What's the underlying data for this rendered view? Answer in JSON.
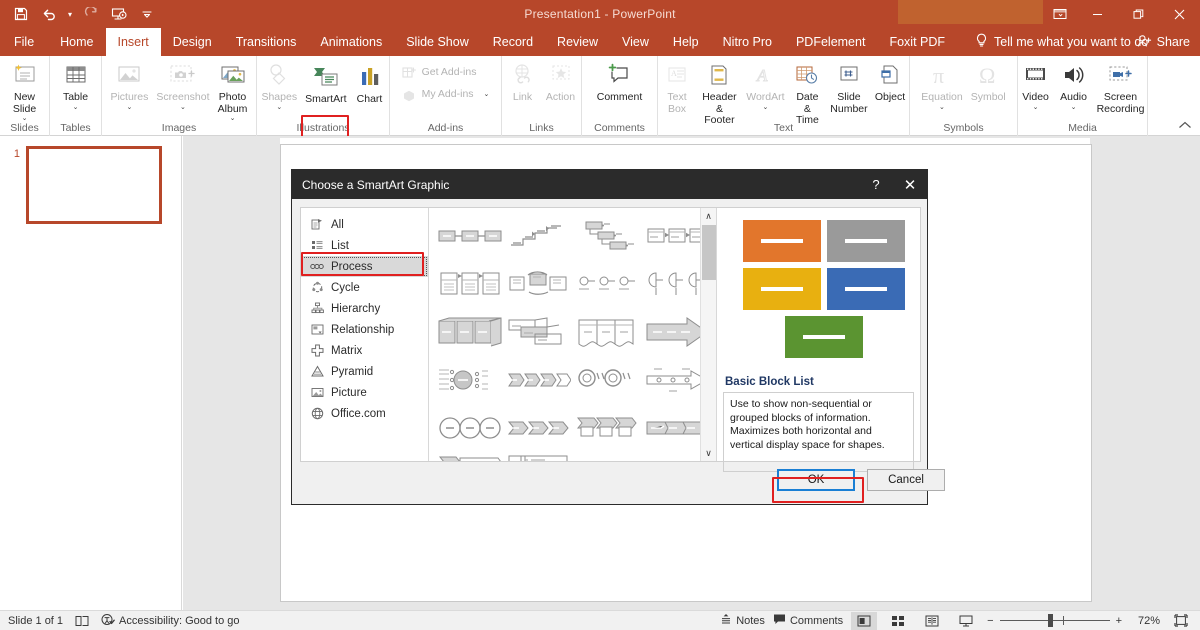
{
  "app": {
    "window_title": "Presentation1  -  PowerPoint",
    "quick_access": [
      {
        "name": "save-icon",
        "label": "Save"
      },
      {
        "name": "undo-icon",
        "label": "Undo"
      },
      {
        "name": "redo-icon",
        "label": "Redo"
      },
      {
        "name": "start-presentation-icon",
        "label": "Start From Beginning"
      },
      {
        "name": "customize-qat-icon",
        "label": "Customize Quick Access Toolbar"
      }
    ],
    "window_controls": [
      {
        "name": "ribbon-display-options",
        "glyph": "⬚"
      },
      {
        "name": "minimize",
        "glyph": "─"
      },
      {
        "name": "restore",
        "glyph": "❐"
      },
      {
        "name": "close",
        "glyph": "✕"
      }
    ],
    "theme_color": "#b7472a"
  },
  "tabs": [
    {
      "label": "File",
      "active": false
    },
    {
      "label": "Home",
      "active": false
    },
    {
      "label": "Insert",
      "active": true
    },
    {
      "label": "Design",
      "active": false
    },
    {
      "label": "Transitions",
      "active": false
    },
    {
      "label": "Animations",
      "active": false
    },
    {
      "label": "Slide Show",
      "active": false
    },
    {
      "label": "Record",
      "active": false
    },
    {
      "label": "Review",
      "active": false
    },
    {
      "label": "View",
      "active": false
    },
    {
      "label": "Help",
      "active": false
    },
    {
      "label": "Nitro Pro",
      "active": false
    },
    {
      "label": "PDFelement",
      "active": false
    },
    {
      "label": "Foxit PDF",
      "active": false
    }
  ],
  "tell_me": {
    "label": "Tell me what you want to do",
    "icon": "lightbulb-icon"
  },
  "share": {
    "label": "Share",
    "icon": "share-person-icon"
  },
  "ribbon": {
    "groups": [
      {
        "label": "Slides",
        "items": [
          {
            "label": "New\nSlide",
            "icon": "new-slide-icon",
            "dropdown": true,
            "disabled": false
          }
        ]
      },
      {
        "label": "Tables",
        "items": [
          {
            "label": "Table",
            "icon": "table-icon",
            "dropdown": true,
            "disabled": false
          }
        ]
      },
      {
        "label": "Images",
        "items": [
          {
            "label": "Pictures",
            "icon": "pictures-icon",
            "dropdown": true,
            "disabled": true
          },
          {
            "label": "Screenshot",
            "icon": "screenshot-icon",
            "dropdown": true,
            "disabled": true
          },
          {
            "label": "Photo\nAlbum",
            "icon": "photo-album-icon",
            "dropdown": true,
            "disabled": false
          }
        ]
      },
      {
        "label": "Illustrations",
        "items": [
          {
            "label": "Shapes",
            "icon": "shapes-icon",
            "dropdown": true,
            "disabled": true
          },
          {
            "label": "SmartArt",
            "icon": "smartart-icon",
            "dropdown": false,
            "disabled": false,
            "highlighted": true
          },
          {
            "label": "Chart",
            "icon": "chart-icon",
            "dropdown": false,
            "disabled": false
          }
        ]
      },
      {
        "label": "Add-ins",
        "items": [
          {
            "label": "Get Add-ins",
            "icon": "get-addins-icon",
            "disabled": true
          },
          {
            "label": "My Add-ins",
            "icon": "my-addins-icon",
            "dropdown": true,
            "disabled": true
          }
        ]
      },
      {
        "label": "Links",
        "items": [
          {
            "label": "Link",
            "icon": "link-icon",
            "disabled": true
          },
          {
            "label": "Action",
            "icon": "action-icon",
            "disabled": true
          }
        ]
      },
      {
        "label": "Comments",
        "items": [
          {
            "label": "Comment",
            "icon": "comment-icon",
            "disabled": false
          }
        ]
      },
      {
        "label": "Text",
        "items": [
          {
            "label": "Text\nBox",
            "icon": "text-box-icon",
            "disabled": true
          },
          {
            "label": "Header\n& Footer",
            "icon": "header-footer-icon",
            "disabled": false
          },
          {
            "label": "WordArt",
            "icon": "wordart-icon",
            "dropdown": true,
            "disabled": true
          },
          {
            "label": "Date &\nTime",
            "icon": "date-time-icon",
            "disabled": false
          },
          {
            "label": "Slide\nNumber",
            "icon": "slide-number-icon",
            "disabled": false
          },
          {
            "label": "Object",
            "icon": "object-icon",
            "disabled": false
          }
        ]
      },
      {
        "label": "Symbols",
        "items": [
          {
            "label": "Equation",
            "icon": "equation-icon",
            "dropdown": true,
            "disabled": true
          },
          {
            "label": "Symbol",
            "icon": "symbol-icon",
            "disabled": true
          }
        ]
      },
      {
        "label": "Media",
        "items": [
          {
            "label": "Video",
            "icon": "video-icon",
            "dropdown": true,
            "disabled": false
          },
          {
            "label": "Audio",
            "icon": "audio-icon",
            "dropdown": true,
            "disabled": false
          },
          {
            "label": "Screen\nRecording",
            "icon": "screen-recording-icon",
            "disabled": false
          }
        ]
      }
    ],
    "collapse_icon": "collapse-ribbon-icon"
  },
  "slides_pane": {
    "slide_number": "1"
  },
  "dialog": {
    "title": "Choose a SmartArt Graphic",
    "help_glyph": "?",
    "close_glyph": "✕",
    "categories": [
      {
        "label": "All",
        "icon": "all-smartart-icon",
        "selected": false
      },
      {
        "label": "List",
        "icon": "list-icon",
        "selected": false
      },
      {
        "label": "Process",
        "icon": "process-icon",
        "selected": true
      },
      {
        "label": "Cycle",
        "icon": "cycle-icon",
        "selected": false
      },
      {
        "label": "Hierarchy",
        "icon": "hierarchy-icon",
        "selected": false
      },
      {
        "label": "Relationship",
        "icon": "relationship-icon",
        "selected": false
      },
      {
        "label": "Matrix",
        "icon": "matrix-icon",
        "selected": false
      },
      {
        "label": "Pyramid",
        "icon": "pyramid-icon",
        "selected": false
      },
      {
        "label": "Picture",
        "icon": "picture-icon",
        "selected": false
      },
      {
        "label": "Office.com",
        "icon": "office-com-icon",
        "selected": false
      }
    ],
    "gallery_scroll": {
      "up_glyph": "∧",
      "down_glyph": "∨"
    },
    "preview": {
      "name": "Basic Block List",
      "description": "Use to show non-sequential or grouped blocks of information. Maximizes both horizontal and vertical display space for shapes.",
      "blocks": [
        {
          "color": "#e2762c"
        },
        {
          "color": "#9a9a9a"
        },
        {
          "color": "#e8b010"
        },
        {
          "color": "#3a6bb5"
        },
        {
          "color": "#5b9431"
        }
      ]
    },
    "buttons": {
      "ok": "OK",
      "cancel": "Cancel"
    }
  },
  "status_bar": {
    "slide_count": "Slide 1 of 1",
    "language_icon": "language-icon",
    "accessibility": "Accessibility: Good to go",
    "notes": "Notes",
    "comments": "Comments",
    "views": [
      {
        "name": "normal-view",
        "active": true
      },
      {
        "name": "slide-sorter-view",
        "active": false
      },
      {
        "name": "reading-view",
        "active": false
      },
      {
        "name": "slide-show-view",
        "active": false
      }
    ],
    "zoom_out": "−",
    "zoom_in": "+",
    "zoom_level": "72%",
    "fit_icon": "fit-slide-icon"
  }
}
